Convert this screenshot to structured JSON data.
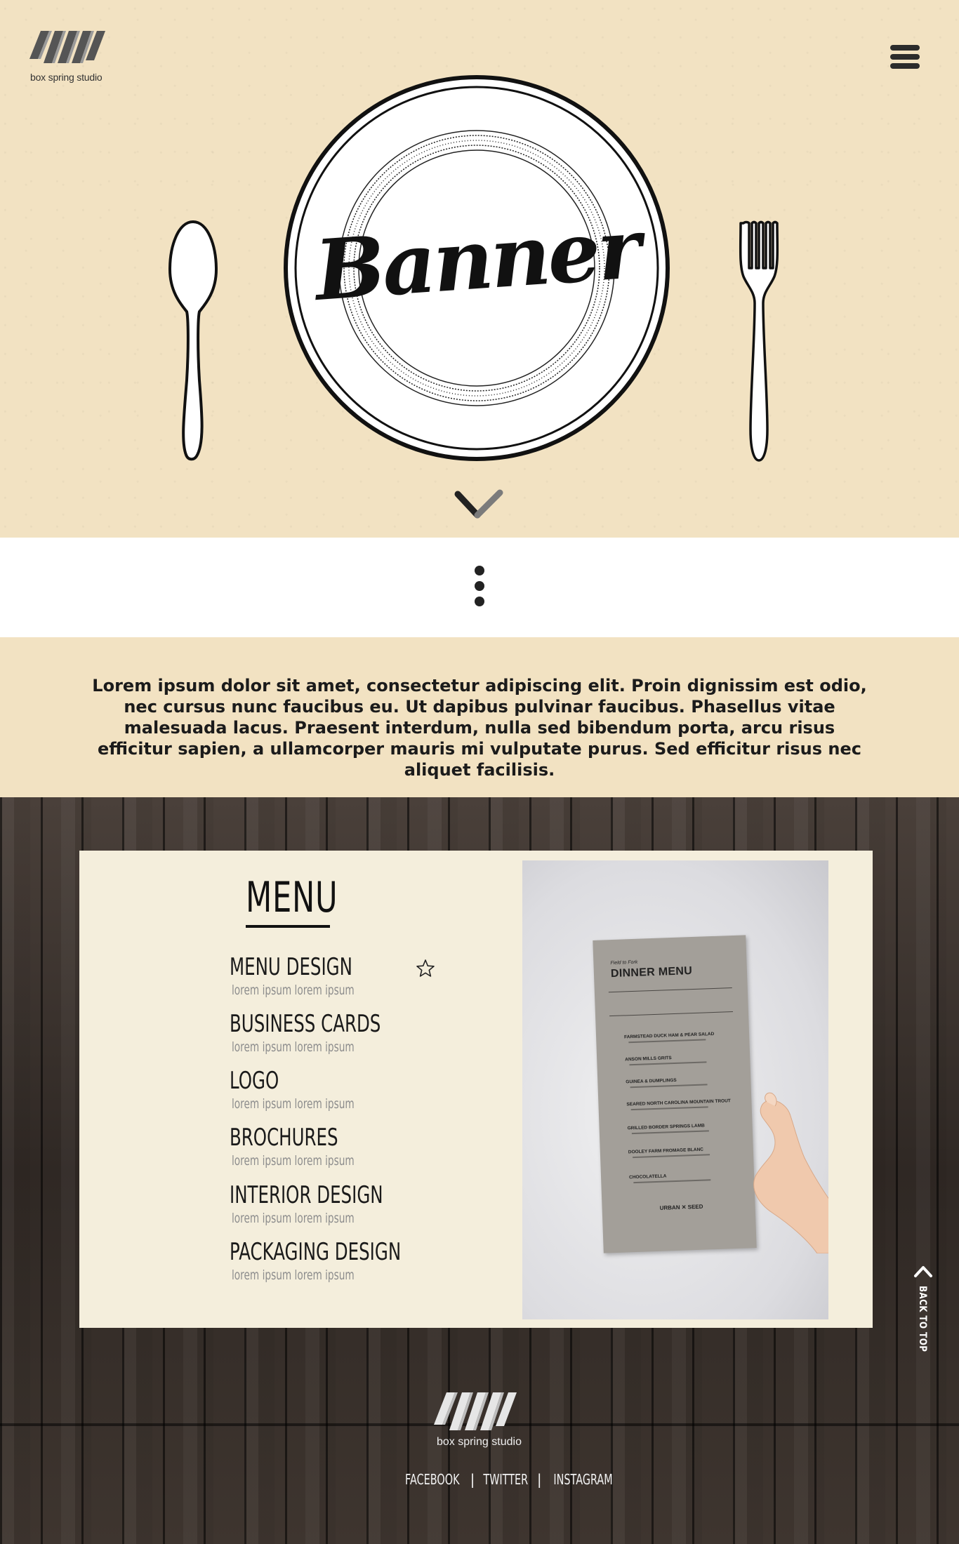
{
  "header": {
    "logo_text": "box spring studio",
    "menu_icon": "hamburger-icon"
  },
  "hero": {
    "title": "Banner",
    "scroll_icon": "chevron-down-icon",
    "left_utensil_icon": "spoon-icon",
    "right_utensil_icon": "fork-icon",
    "plate_icon": "plate-icon"
  },
  "divider": {
    "icon": "vertical-dots-icon"
  },
  "intro": {
    "text": "Lorem ipsum dolor sit amet, consectetur adipiscing elit. Proin dignissim est odio, nec cursus nunc faucibus eu. Ut dapibus pulvinar faucibus. Phasellus vitae malesuada lacus. Praesent interdum, nulla sed bibendum porta, arcu risus efficitur sapien, a ullamcorper mauris mi vulputate purus. Sed efficitur risus nec aliquet facilisis."
  },
  "menu": {
    "title": "MENU",
    "items": [
      {
        "label": "MENU DESIGN",
        "sub": "lorem ipsum lorem ipsum"
      },
      {
        "label": "BUSINESS CARDS",
        "sub": "lorem ipsum lorem ipsum"
      },
      {
        "label": "LOGO",
        "sub": "lorem ipsum lorem ipsum"
      },
      {
        "label": "BROCHURES",
        "sub": "lorem ipsum lorem ipsum"
      },
      {
        "label": "INTERIOR DESIGN",
        "sub": "lorem ipsum lorem ipsum"
      },
      {
        "label": "PACKAGING DESIGN",
        "sub": "lorem ipsum lorem ipsum"
      }
    ],
    "favorite_icon": "star-icon"
  },
  "photo": {
    "paper_kicker": "Field to Fork",
    "paper_title": "DINNER MENU",
    "dishes": [
      "FARMSTEAD DUCK HAM & PEAR SALAD",
      "ANSON MILLS GRITS",
      "GUINEA & DUMPLINGS",
      "SEARED NORTH CAROLINA MOUNTAIN TROUT",
      "GRILLED BORDER SPRINGS LAMB",
      "DOOLEY FARM FROMAGE BLANC",
      "CHOCOLATELLA"
    ],
    "brand": "URBAN ✕ SEED"
  },
  "back_to_top": {
    "label": "BACK TO TOP",
    "icon": "chevron-up-icon"
  },
  "footer": {
    "logo_text": "box spring studio",
    "links": [
      "FACEBOOK",
      "TWITTER",
      "INSTAGRAM"
    ],
    "separator": "|"
  }
}
